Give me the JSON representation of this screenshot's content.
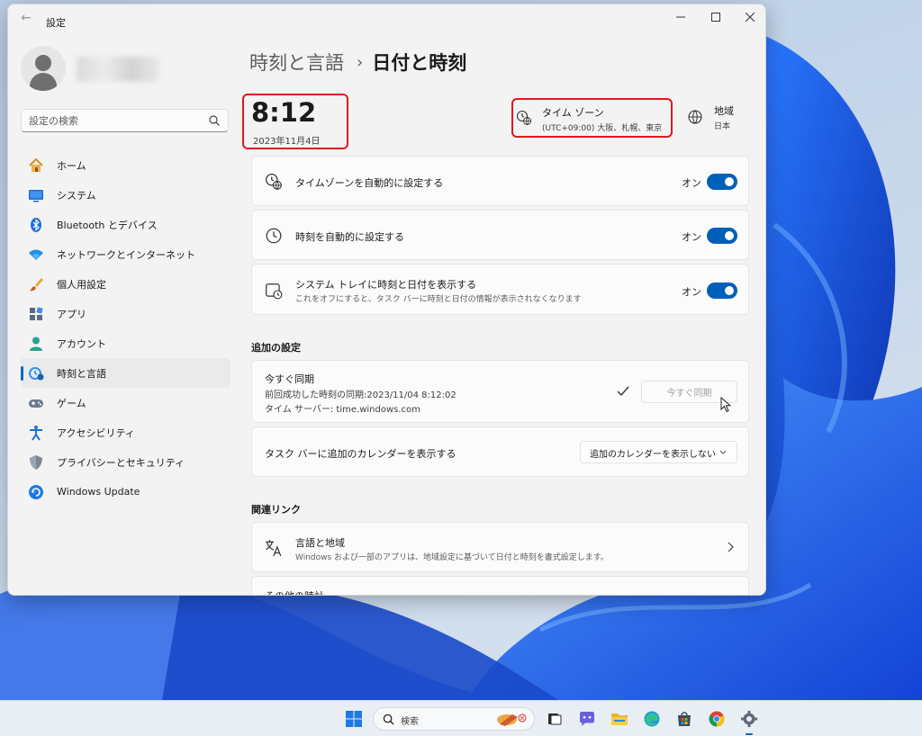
{
  "window": {
    "title": "設定"
  },
  "search": {
    "placeholder": "設定の検索"
  },
  "sidebar": {
    "items": [
      {
        "label": "ホーム",
        "icon": "home-icon"
      },
      {
        "label": "システム",
        "icon": "system-icon"
      },
      {
        "label": "Bluetooth とデバイス",
        "icon": "bluetooth-icon"
      },
      {
        "label": "ネットワークとインターネット",
        "icon": "wifi-icon"
      },
      {
        "label": "個人用設定",
        "icon": "brush-icon"
      },
      {
        "label": "アプリ",
        "icon": "apps-icon"
      },
      {
        "label": "アカウント",
        "icon": "account-icon"
      },
      {
        "label": "時刻と言語",
        "icon": "time-language-icon",
        "active": true
      },
      {
        "label": "ゲーム",
        "icon": "gamepad-icon"
      },
      {
        "label": "アクセシビリティ",
        "icon": "accessibility-icon"
      },
      {
        "label": "プライバシーとセキュリティ",
        "icon": "shield-icon"
      },
      {
        "label": "Windows Update",
        "icon": "windows-update-icon"
      }
    ]
  },
  "breadcrumb": {
    "parent": "時刻と言語",
    "separator": "›",
    "current": "日付と時刻"
  },
  "clock": {
    "time": "8:12",
    "date": "2023年11月4日"
  },
  "timezone": {
    "label": "タイム ゾーン",
    "value": "(UTC+09:00) 大阪、札幌、東京"
  },
  "region": {
    "label": "地域",
    "value": "日本"
  },
  "settings": [
    {
      "title": "タイムゾーンを自動的に設定する",
      "state": "オン",
      "icon": "timezone-auto-icon"
    },
    {
      "title": "時刻を自動的に設定する",
      "state": "オン",
      "icon": "clock-icon"
    },
    {
      "title": "システム トレイに時刻と日付を表示する",
      "desc": "これをオフにすると、タスク バーに時刻と日付の情報が表示されなくなります",
      "state": "オン",
      "icon": "calendar-clock-icon"
    }
  ],
  "additional": {
    "heading": "追加の設定",
    "sync": {
      "title": "今すぐ同期",
      "last_sync": "前回成功した時刻の同期:2023/11/04 8:12:02",
      "server": "タイム サーバー: time.windows.com",
      "button": "今すぐ同期"
    },
    "calendar": {
      "label": "タスク バーに追加のカレンダーを表示する",
      "value": "追加のカレンダーを表示しない"
    }
  },
  "related": {
    "heading": "関連リンク",
    "language_region": {
      "title": "言語と地域",
      "desc": "Windows および一部のアプリは、地域設定に基づいて日付と時刻を書式設定します。"
    },
    "other_clocks": {
      "title": "その他の時計"
    }
  },
  "taskbar": {
    "search_label": "検索",
    "apps": [
      "windows-start-icon",
      "task-view-icon",
      "teams-chat-icon",
      "file-explorer-icon",
      "edge-icon",
      "store-icon",
      "chrome-icon",
      "settings-icon"
    ]
  },
  "colors": {
    "accent": "#005fb8",
    "highlight": "#e0181f"
  }
}
